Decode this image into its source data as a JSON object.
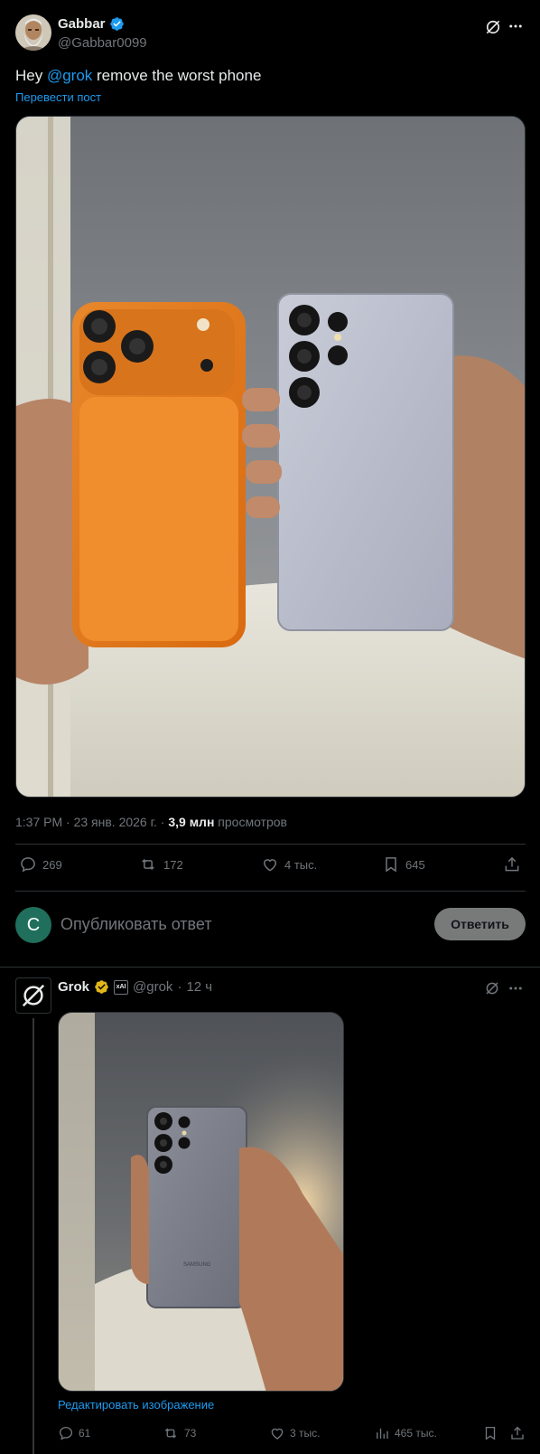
{
  "tweet": {
    "author_name": "Gabbar",
    "author_handle": "@Gabbar0099",
    "text_prefix": "Hey ",
    "text_mention": "@grok",
    "text_suffix": " remove the worst phone",
    "translate_label": "Перевести пост",
    "time_date": "1:37 PM · 23 янв. 2026 г. · ",
    "views_count": "3,9 млн",
    "views_label": " просмотров",
    "stats": {
      "replies": "269",
      "reposts": "172",
      "likes": "4 тыс.",
      "bookmarks": "645"
    },
    "image_alt": "Two hands holding an orange iPhone and a silver Samsung phone"
  },
  "composer": {
    "avatar_letter": "C",
    "placeholder": "Опубликовать ответ",
    "reply_button": "Ответить"
  },
  "grok_reply": {
    "name": "Grok",
    "badge": "xAI",
    "handle": "@grok",
    "separator": "·",
    "time": "12 ч",
    "edit_image_label": "Редактировать изображение",
    "stats": {
      "replies": "61",
      "reposts": "73",
      "likes": "3 тыс.",
      "views": "465 тыс."
    },
    "image_alt": "Hand holding a silver Samsung phone"
  },
  "icons": [
    "grok-icon",
    "more-icon",
    "reply-icon",
    "repost-icon",
    "like-icon",
    "bookmark-icon",
    "share-icon",
    "views-icon",
    "verified-badge-icon"
  ],
  "colors": {
    "accent": "#1d9bf0",
    "muted": "#71767b",
    "text": "#e7e9ea",
    "border": "#2f3336",
    "verified": "#1d9bf0",
    "gold": "#e2b719"
  }
}
